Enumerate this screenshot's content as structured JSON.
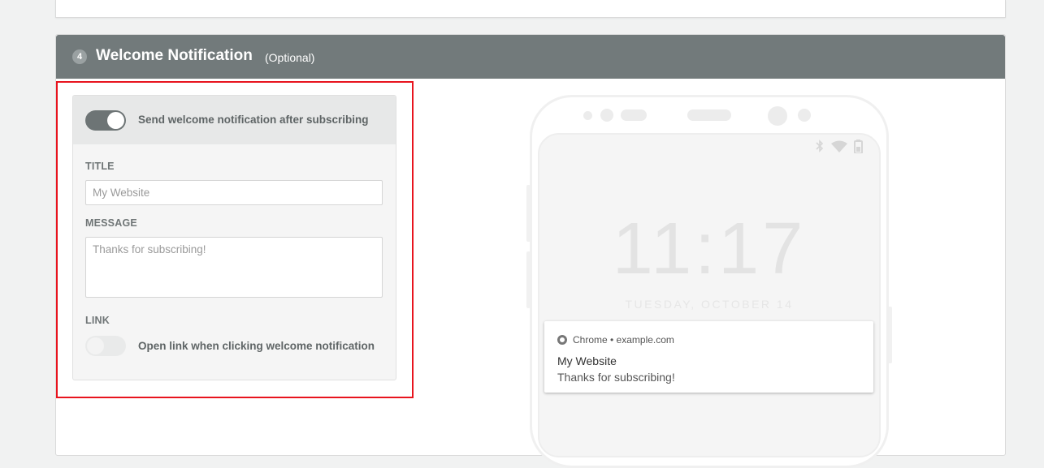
{
  "section": {
    "step": "4",
    "title": "Welcome Notification",
    "optional_label": "(Optional)"
  },
  "settings": {
    "send_toggle": {
      "label": "Send welcome notification after subscribing",
      "enabled": true
    },
    "title_field": {
      "label": "TITLE",
      "placeholder": "My Website",
      "value": ""
    },
    "message_field": {
      "label": "MESSAGE",
      "placeholder": "Thanks for subscribing!",
      "value": ""
    },
    "link": {
      "label": "LINK",
      "toggle_label": "Open link when clicking welcome notification",
      "enabled": false
    }
  },
  "preview": {
    "clock": "11:17",
    "date": "TUESDAY, OCTOBER 14",
    "status_icons": [
      "bluetooth-icon",
      "wifi-icon",
      "battery-icon"
    ],
    "notification": {
      "app_icon": "chrome-icon",
      "app_line": "Chrome • example.com",
      "title": "My Website",
      "message": "Thanks for subscribing!"
    }
  },
  "colors": {
    "header_bg": "#727a7b",
    "highlight_border": "#e8141e",
    "toggle_on": "#6d7475"
  }
}
